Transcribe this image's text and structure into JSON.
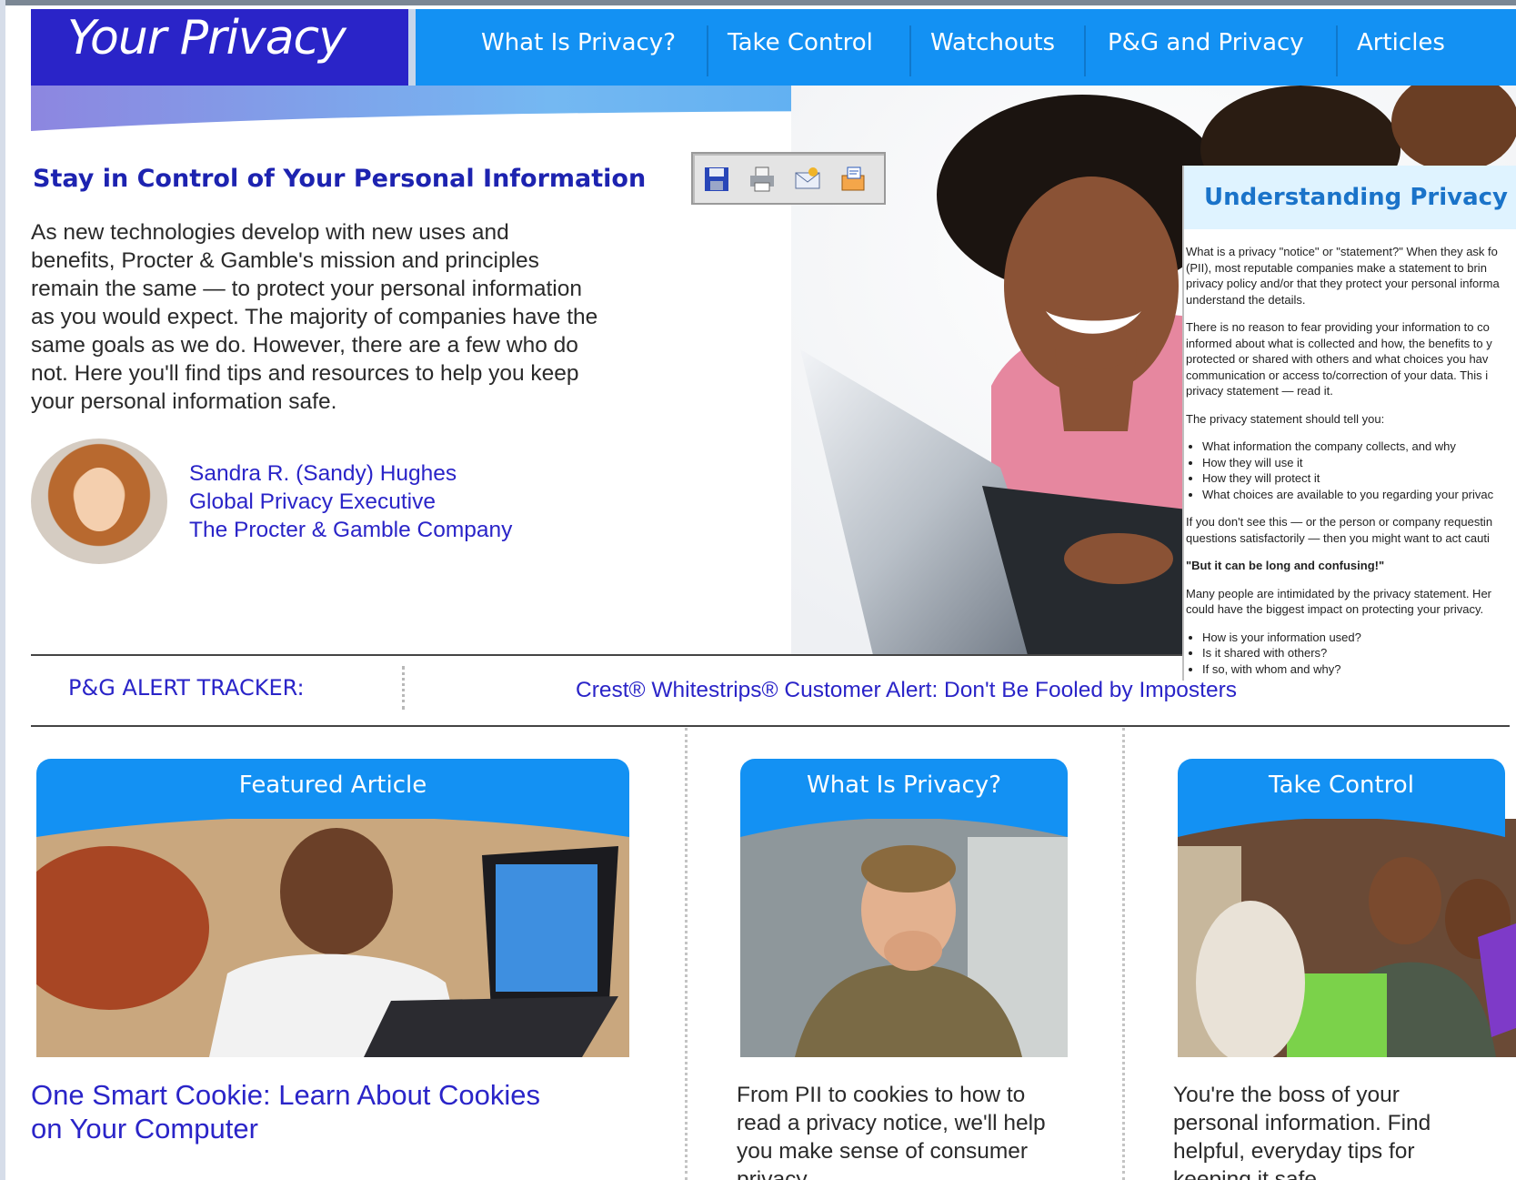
{
  "header": {
    "brand": "Your Privacy",
    "nav": [
      "What Is Privacy?",
      "Take Control",
      "Watchouts",
      "P&G and Privacy",
      "Articles"
    ]
  },
  "intro": {
    "headline": "Stay in Control of Your Personal Information",
    "lines": [
      "As new technologies develop with new uses and",
      "benefits, Procter & Gamble's mission and principles",
      "remain the same — to protect your personal information",
      "as you would expect. The majority of companies have the",
      "same goals as we do. However, there are a few who do",
      "not. Here you'll find tips and resources to help you keep",
      "your personal information safe."
    ],
    "signature": [
      "Sandra R. (Sandy) Hughes",
      "Global Privacy Executive",
      "The Procter & Gamble Company"
    ]
  },
  "toolbar": {
    "icons": [
      "save-icon",
      "print-icon",
      "email-icon",
      "share-icon"
    ]
  },
  "popup": {
    "title": "Understanding Privacy Stat",
    "p1": [
      "What is a privacy \"notice\" or \"statement?\" When they ask fo",
      "(PII), most reputable companies make a statement to brin",
      "privacy policy and/or that they protect your personal informa",
      "understand the details."
    ],
    "p2": [
      "There is no reason to fear providing your information to co",
      "informed about what is collected and how, the benefits to y",
      "protected or shared with others and what choices you hav",
      "communication or access to/correction of your data. This i",
      "privacy statement — read it."
    ],
    "p3": "The privacy statement should tell you:",
    "list1": [
      "What information the company collects, and why",
      "How they will use it",
      "How they will protect it",
      "What choices are available to you regarding your privac"
    ],
    "p4": [
      "If you don't see this — or the person or company requestin",
      "questions satisfactorily — then you might want to act cauti"
    ],
    "p5": "\"But it can be long and confusing!\"",
    "p6": [
      "Many people are intimidated by the privacy statement. Her",
      "could have the biggest impact on protecting your privacy."
    ],
    "list2": [
      "How is your information used?",
      "Is it shared with others?",
      "If so, with whom and why?"
    ]
  },
  "alert": {
    "label": "P&G ALERT TRACKER:",
    "link": "Crest® Whitestrips® Customer Alert: Don't Be Fooled by Imposters"
  },
  "cards": [
    {
      "header": "Featured Article",
      "title_lines": [
        "One Smart Cookie: Learn About Cookies",
        "on Your Computer"
      ]
    },
    {
      "header": "What Is Privacy?",
      "desc_lines": [
        "From PII to cookies to how to",
        "read a privacy notice, we'll help",
        "you make sense of consumer",
        "privacy."
      ]
    },
    {
      "header": "Take Control",
      "desc_lines": [
        "You're the boss of your",
        "personal information. Find",
        "helpful, everyday tips for",
        "keeping it safe."
      ]
    }
  ],
  "colors": {
    "brand_blue": "#2a24c8",
    "nav_blue": "#1391f3",
    "popup_title": "#1a73c9"
  }
}
